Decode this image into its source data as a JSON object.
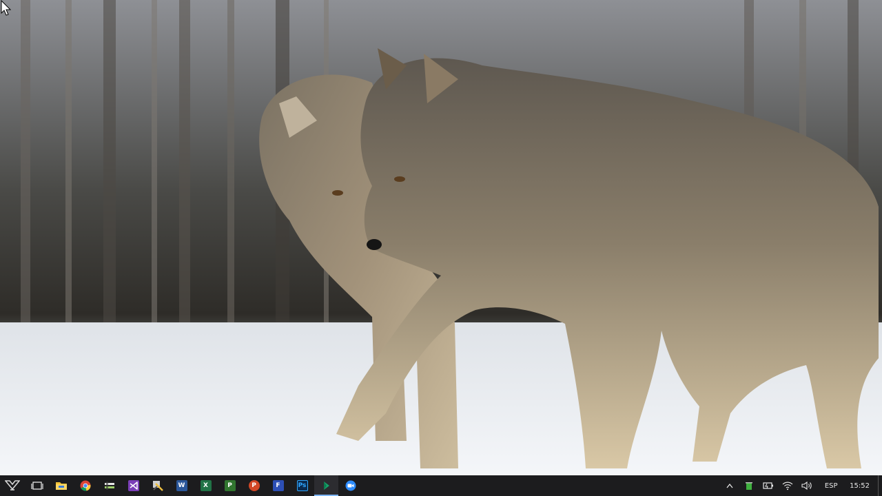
{
  "desktop": {
    "wallpaper": "two-gray-wolves-snow"
  },
  "taskbar": {
    "start_icon": "start-icon",
    "apps": [
      {
        "name": "task-view",
        "icon": "task-view-icon",
        "color": "#e6e6e6"
      },
      {
        "name": "file-explorer",
        "icon": "folder-icon",
        "color": "#f3c338"
      },
      {
        "name": "chrome",
        "icon": "chrome-icon",
        "color": "#4b8bf4"
      },
      {
        "name": "toolbox",
        "icon": "tools-icon",
        "color": "#cfcfcf"
      },
      {
        "name": "visual-studio",
        "icon": "visual-studio-icon",
        "color": "#7b3fb8"
      },
      {
        "name": "utility",
        "icon": "utility-icon",
        "color": "#d0d0d0"
      },
      {
        "name": "word",
        "icon": "word-icon",
        "color": "#2b579a",
        "label": "W"
      },
      {
        "name": "excel",
        "icon": "excel-icon",
        "color": "#217346",
        "label": "X"
      },
      {
        "name": "project",
        "icon": "project-icon",
        "color": "#31752f",
        "label": "P"
      },
      {
        "name": "powerpoint",
        "icon": "powerpoint-icon",
        "color": "#d24726",
        "label": "P"
      },
      {
        "name": "flow-app",
        "icon": "flow-icon",
        "color": "#2d4fb5",
        "label": "F"
      },
      {
        "name": "photoshop",
        "icon": "photoshop-icon",
        "color": "#0a2a4f",
        "label": "Ps"
      },
      {
        "name": "camtasia",
        "icon": "camtasia-icon",
        "color": "#16a36a"
      },
      {
        "name": "zoom",
        "icon": "zoom-icon",
        "color": "#2d8cff"
      }
    ],
    "tray": {
      "chevron_icon": "chevron-up-icon",
      "language": "ESP",
      "time": "15:52"
    }
  }
}
